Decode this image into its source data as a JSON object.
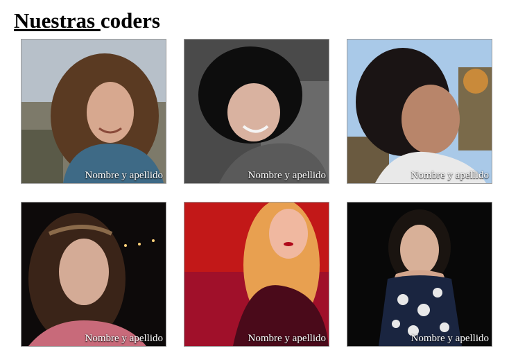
{
  "heading": {
    "part1": "Nuestras ",
    "part2": "coders"
  },
  "coders": [
    {
      "caption": "Nombre y apellido",
      "photo": "woman-curly-hair-photo"
    },
    {
      "caption": "Nombre y apellido",
      "photo": "woman-short-black-hair-photo"
    },
    {
      "caption": "Nombre y apellido",
      "photo": "woman-profile-outdoors-photo"
    },
    {
      "caption": "Nombre y apellido",
      "photo": "woman-headband-night-photo"
    },
    {
      "caption": "Nombre y apellido",
      "photo": "woman-red-lighting-photo"
    },
    {
      "caption": "Nombre y apellido",
      "photo": "woman-floral-dress-photo"
    }
  ]
}
